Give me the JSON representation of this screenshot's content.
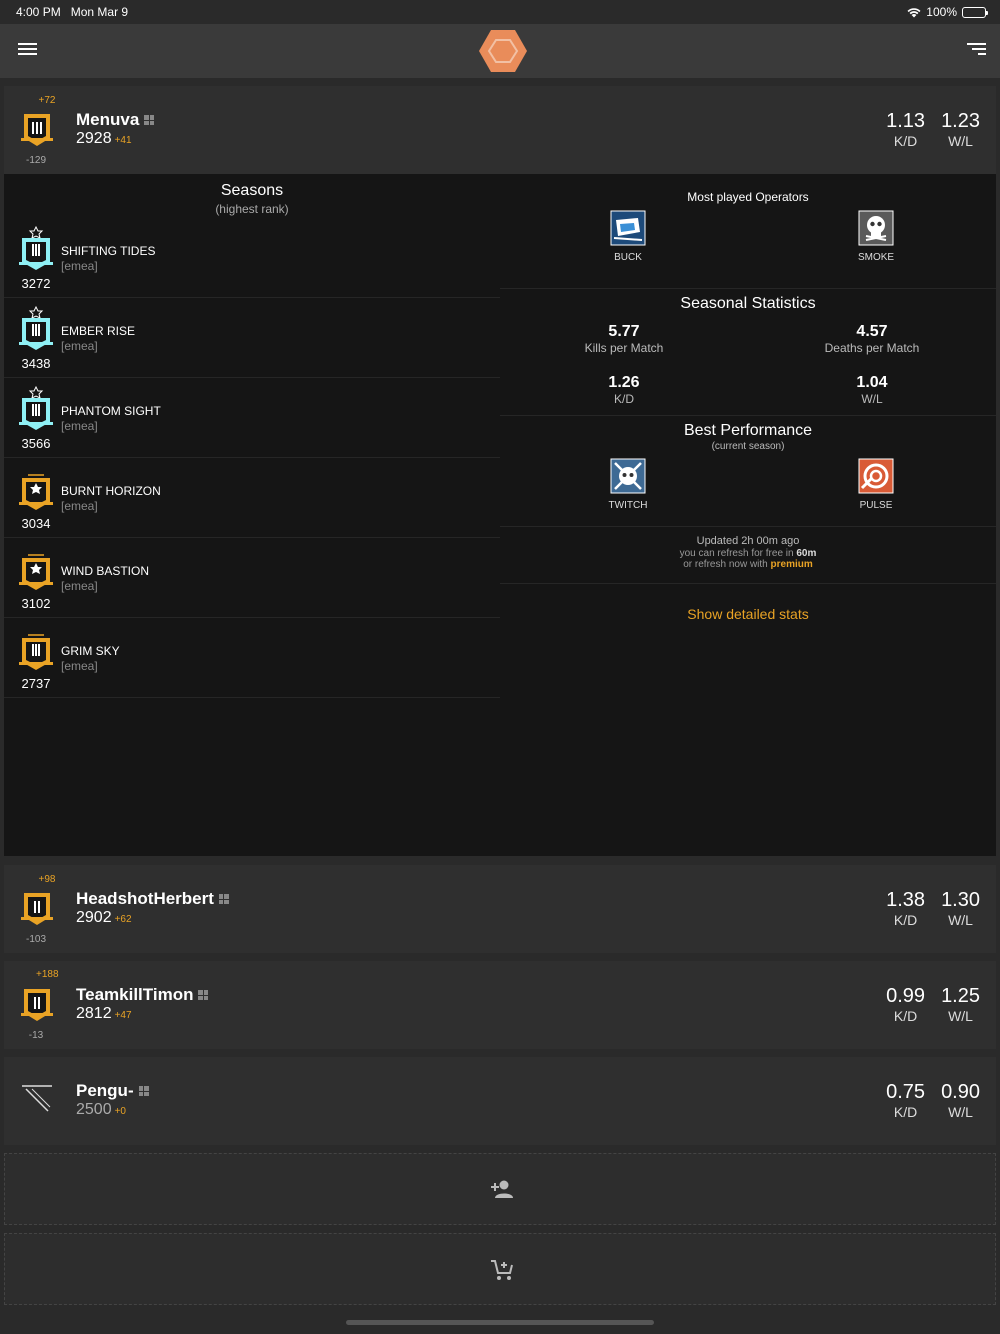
{
  "status": {
    "time": "4:00 PM",
    "date": "Mon Mar 9",
    "battery": "100%",
    "wifi_icon": "wifi-icon"
  },
  "colors": {
    "accent": "#e9a325",
    "background": "#2a2a2a",
    "card": "#2f2f2f",
    "panel": "#151515",
    "diamond": "#8ff0f5",
    "gold": "#e9a325",
    "logo": "#e98c5a"
  },
  "players": [
    {
      "name": "Menuva",
      "mmr": "2928",
      "delta": "+41",
      "rank_up": "+72",
      "rank_down": "-129",
      "kd": "1.13",
      "wl": "1.23",
      "kd_label": "K/D",
      "wl_label": "W/L"
    },
    {
      "name": "HeadshotHerbert",
      "mmr": "2902",
      "delta": "+62",
      "rank_up": "+98",
      "rank_down": "-103",
      "kd": "1.38",
      "wl": "1.30",
      "kd_label": "K/D",
      "wl_label": "W/L"
    },
    {
      "name": "TeamkillTimon",
      "mmr": "2812",
      "delta": "+47",
      "rank_up": "+188",
      "rank_down": "-13",
      "kd": "0.99",
      "wl": "1.25",
      "kd_label": "K/D",
      "wl_label": "W/L"
    },
    {
      "name": "Pengu-",
      "mmr": "2500",
      "delta": "+0",
      "kd": "0.75",
      "wl": "0.90",
      "kd_label": "K/D",
      "wl_label": "W/L"
    }
  ],
  "seasons": {
    "title": "Seasons",
    "subtitle": "(highest rank)",
    "items": [
      {
        "name": "SHIFTING TIDES",
        "region": "[emea]",
        "mmr": "3272"
      },
      {
        "name": "EMBER RISE",
        "region": "[emea]",
        "mmr": "3438"
      },
      {
        "name": "PHANTOM SIGHT",
        "region": "[emea]",
        "mmr": "3566"
      },
      {
        "name": "BURNT HORIZON",
        "region": "[emea]",
        "mmr": "3034"
      },
      {
        "name": "WIND BASTION",
        "region": "[emea]",
        "mmr": "3102"
      },
      {
        "name": "GRIM SKY",
        "region": "[emea]",
        "mmr": "2737"
      }
    ]
  },
  "operators": {
    "title": "Most played Operators",
    "items": [
      {
        "name": "BUCK"
      },
      {
        "name": "SMOKE"
      }
    ]
  },
  "seasonal": {
    "title": "Seasonal Statistics",
    "kpm": "5.77",
    "kpm_label": "Kills per Match",
    "dpm": "4.57",
    "dpm_label": "Deaths per Match",
    "kd": "1.26",
    "kd_label": "K/D",
    "wl": "1.04",
    "wl_label": "W/L"
  },
  "best": {
    "title": "Best Performance",
    "subtitle": "(current season)",
    "items": [
      {
        "name": "TWITCH"
      },
      {
        "name": "PULSE"
      }
    ]
  },
  "update": {
    "line1": "Updated 2h 00m ago",
    "line2_prefix": "you can refresh for free in ",
    "line2_time": "60m",
    "line3_prefix": "or refresh now with ",
    "line3_link": "premium"
  },
  "show_detail": "Show detailed stats"
}
